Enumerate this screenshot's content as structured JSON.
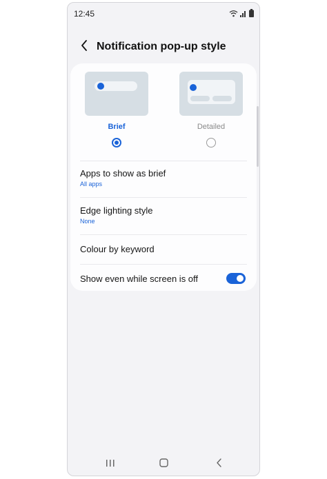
{
  "status_bar": {
    "time": "12:45"
  },
  "header": {
    "title": "Notification pop-up style"
  },
  "style_options": [
    {
      "label": "Brief",
      "selected": true
    },
    {
      "label": "Detailed",
      "selected": false
    }
  ],
  "settings": [
    {
      "title": "Apps to show as brief",
      "subtitle": "All apps"
    },
    {
      "title": "Edge lighting style",
      "subtitle": "None"
    },
    {
      "title": "Colour by keyword"
    },
    {
      "title": "Show even while screen is off",
      "toggle_on": true
    }
  ],
  "colors": {
    "accent": "#1a63d8",
    "background": "#f3f3f6",
    "card": "#fdfdfe",
    "preview": "#d6dee4"
  }
}
